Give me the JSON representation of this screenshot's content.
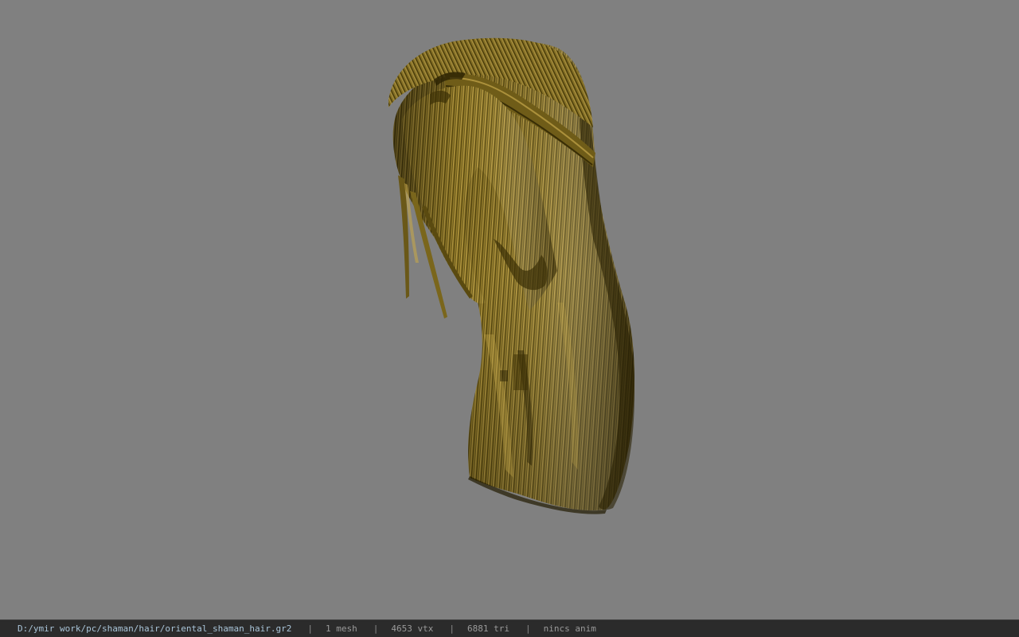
{
  "viewport": {
    "background_color": "#808080",
    "model_colors": {
      "hair_base": "#8a7422",
      "hair_light": "#c9ab4c",
      "hair_dark": "#3e3206",
      "hair_shadow": "#221b02"
    },
    "model_description": "3D hair mesh"
  },
  "status": {
    "file_path": "D:/ymir work/pc/shaman/hair/oriental_shaman_hair.gr2",
    "separator": "|",
    "mesh_count": "1 mesh",
    "vertex_count": "4653 vtx",
    "triangle_count": "6881 tri",
    "anim_status": "nincs anim"
  }
}
